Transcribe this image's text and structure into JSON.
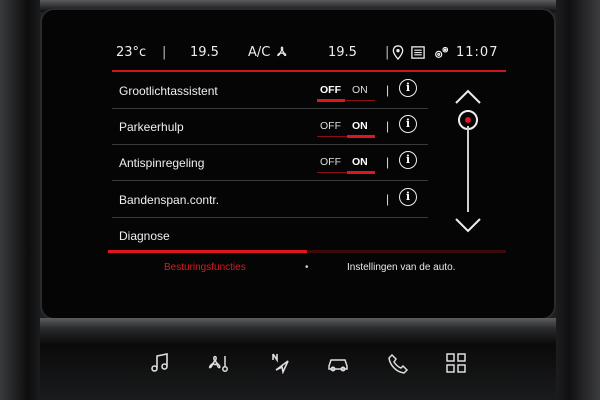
{
  "status_bar": {
    "outside_temp": "23°c",
    "temp_left": "19.5",
    "ac_label": "A/C",
    "temp_right": "19.5",
    "time": "11:07"
  },
  "settings": {
    "rows": [
      {
        "label": "Grootlichtassistent",
        "off_label": "OFF",
        "on_label": "ON",
        "state": "off"
      },
      {
        "label": "Parkeerhulp",
        "off_label": "OFF",
        "on_label": "ON",
        "state": "on"
      },
      {
        "label": "Antispinregeling",
        "off_label": "OFF",
        "on_label": "ON",
        "state": "on"
      },
      {
        "label": "Bandenspan.contr."
      }
    ],
    "diagnose_label": "Diagnose",
    "info_glyph": "i"
  },
  "progress": {
    "fraction": 0.5
  },
  "footer": {
    "left_tab": "Besturingsfuncties",
    "dot": "•",
    "right_tab": "Instellingen van de auto."
  },
  "colors": {
    "accent": "#e0161e",
    "screen_bg": "#050506",
    "text": "#f0f0f0"
  },
  "icons": {
    "status": [
      "fan-icon",
      "location-icon",
      "document-icon",
      "gear-icon"
    ],
    "physical_buttons": [
      "music-icon",
      "climate-fan-icon",
      "navigation-icon",
      "car-icon",
      "phone-icon",
      "apps-grid-icon"
    ]
  }
}
